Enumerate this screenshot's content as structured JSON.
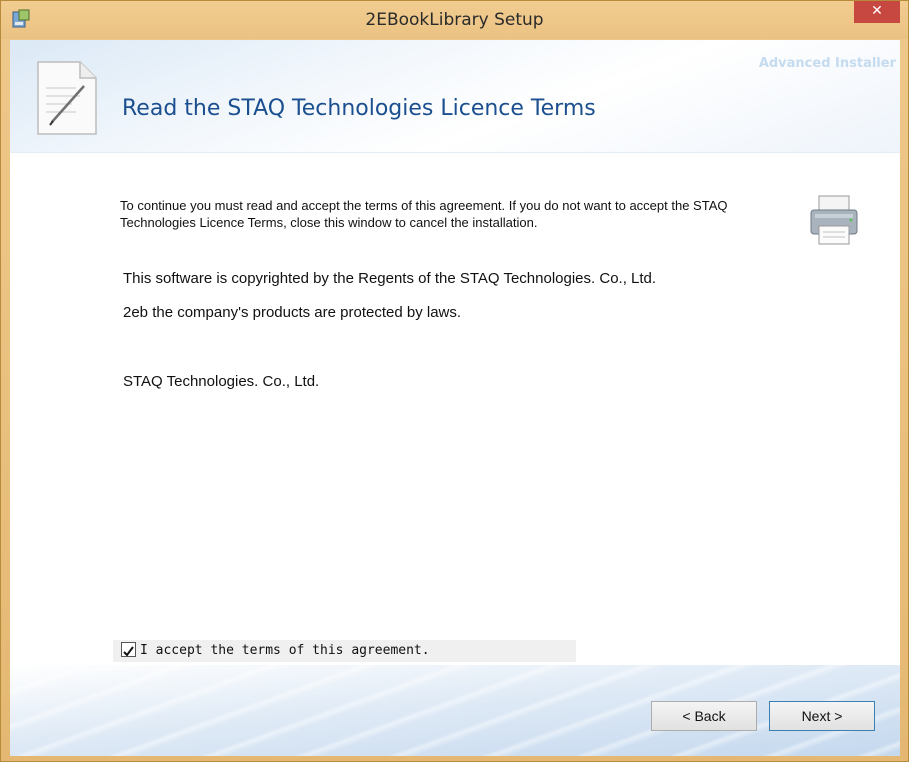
{
  "window": {
    "title": "2EBookLibrary Setup",
    "close_glyph": "✕",
    "app_icon": "installer-icon"
  },
  "header": {
    "brand": "Advanced Installer",
    "title": "Read the STAQ Technologies Licence Terms",
    "icon": "document-pen-icon"
  },
  "intro": {
    "text": "To continue you must read and accept the terms of this agreement. If you do not want to accept the STAQ Technologies Licence Terms, close this window to cancel the installation."
  },
  "print_button": {
    "icon": "printer-icon"
  },
  "licence": {
    "lines": [
      "This software is copyrighted by the Regents of the STAQ Technologies. Co., Ltd.",
      "2eb the company's products are protected by laws.",
      "STAQ Technologies. Co., Ltd."
    ]
  },
  "accept": {
    "label": "I accept the terms of this agreement.",
    "checked": true
  },
  "buttons": {
    "back": "< Back",
    "next": "Next >"
  },
  "colors": {
    "title_blue": "#1b4f8f",
    "close_red": "#c64841",
    "frame": "#ecc98a"
  }
}
